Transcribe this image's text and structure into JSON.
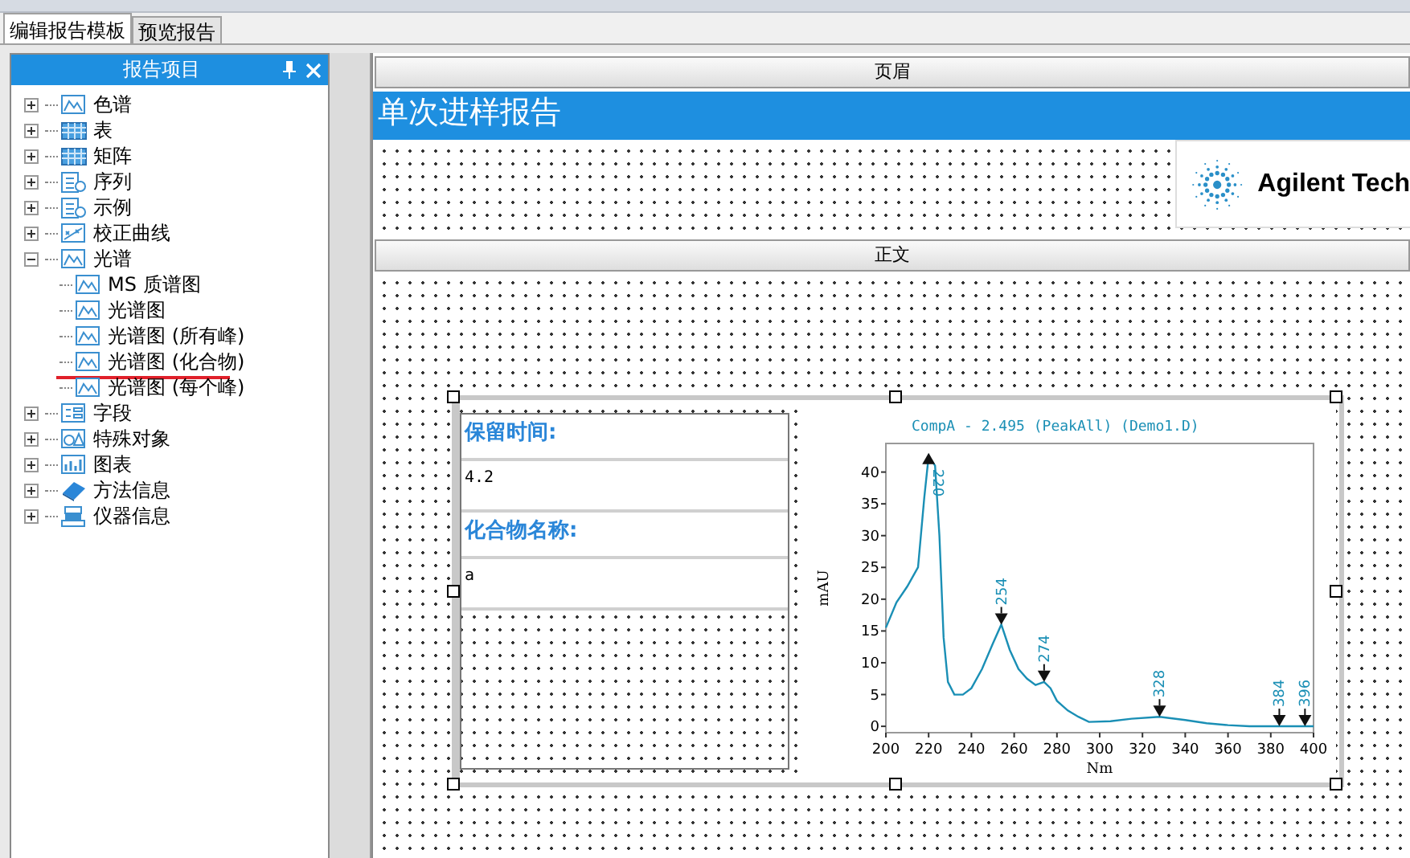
{
  "tabs": [
    {
      "label": "编辑报告模板",
      "selected": true
    },
    {
      "label": "预览报告",
      "selected": false
    }
  ],
  "panel": {
    "title": "报告项目",
    "items": [
      {
        "label": "色谱",
        "kind": "chart",
        "expanded": false
      },
      {
        "label": "表",
        "kind": "table",
        "expanded": false
      },
      {
        "label": "矩阵",
        "kind": "table",
        "expanded": false
      },
      {
        "label": "序列",
        "kind": "sequence",
        "expanded": false
      },
      {
        "label": "示例",
        "kind": "sequence",
        "expanded": false
      },
      {
        "label": "校正曲线",
        "kind": "calibration",
        "expanded": false
      },
      {
        "label": "光谱",
        "kind": "chart",
        "expanded": true,
        "children": [
          {
            "label": "MS 质谱图",
            "kind": "chart",
            "underlined": false
          },
          {
            "label": "光谱图",
            "kind": "chart",
            "underlined": false
          },
          {
            "label": "光谱图 (所有峰)",
            "kind": "chart",
            "underlined": false
          },
          {
            "label": "光谱图 (化合物)",
            "kind": "chart",
            "underlined": true
          },
          {
            "label": "光谱图 (每个峰)",
            "kind": "chart",
            "underlined": false
          }
        ]
      },
      {
        "label": "字段",
        "kind": "field",
        "expanded": false
      },
      {
        "label": "特殊对象",
        "kind": "special",
        "expanded": false
      },
      {
        "label": "图表",
        "kind": "graph",
        "expanded": false
      },
      {
        "label": "方法信息",
        "kind": "method",
        "expanded": false
      },
      {
        "label": "仪器信息",
        "kind": "instrument",
        "expanded": false
      }
    ]
  },
  "designer": {
    "header_band": "页眉",
    "report_title": "单次进样报告",
    "logo_text": "Agilent Tech",
    "body_band": "正文",
    "fields": [
      {
        "kind": "label",
        "text": "保留时间:"
      },
      {
        "kind": "value",
        "text": "4.2"
      },
      {
        "kind": "label",
        "text": "化合物名称:"
      },
      {
        "kind": "value",
        "text": "a"
      }
    ],
    "chart_data": {
      "type": "line",
      "title": "CompA - 2.495 (PeakAll)  (Demo1.D)",
      "xlabel": "Nm",
      "ylabel": "mAU",
      "x": [
        200,
        205,
        210,
        215,
        218,
        220,
        223,
        225,
        227,
        229,
        232,
        236,
        240,
        245,
        250,
        254,
        258,
        262,
        266,
        270,
        274,
        277,
        280,
        285,
        290,
        295,
        305,
        315,
        328,
        340,
        350,
        360,
        370,
        384,
        396,
        400
      ],
      "series": [
        {
          "color": "#1a8fb5",
          "values": [
            15.5,
            19.5,
            22,
            25,
            36,
            42.5,
            41,
            30,
            14,
            7,
            5,
            5,
            6,
            9,
            13,
            16,
            12,
            9,
            7.5,
            6.5,
            7,
            6,
            4,
            2.5,
            1.5,
            0.7,
            0.8,
            1.2,
            1.5,
            1,
            0.5,
            0.2,
            0,
            0,
            0,
            0
          ]
        }
      ],
      "xlim": [
        200,
        400
      ],
      "ylim": [
        -1,
        44.5
      ],
      "xticks": [
        200,
        220,
        240,
        260,
        280,
        300,
        320,
        340,
        360,
        380,
        400
      ],
      "yticks": [
        0,
        5,
        10,
        15,
        20,
        25,
        30,
        35,
        40
      ],
      "annotations": [
        {
          "x": 220,
          "y": 42.5,
          "text": "220"
        },
        {
          "x": 254,
          "y": 16,
          "text": "254"
        },
        {
          "x": 274,
          "y": 7,
          "text": "274"
        },
        {
          "x": 328,
          "y": 1.5,
          "text": "328"
        },
        {
          "x": 384,
          "y": 0,
          "text": "384"
        },
        {
          "x": 396,
          "y": 0,
          "text": "396"
        }
      ]
    }
  }
}
